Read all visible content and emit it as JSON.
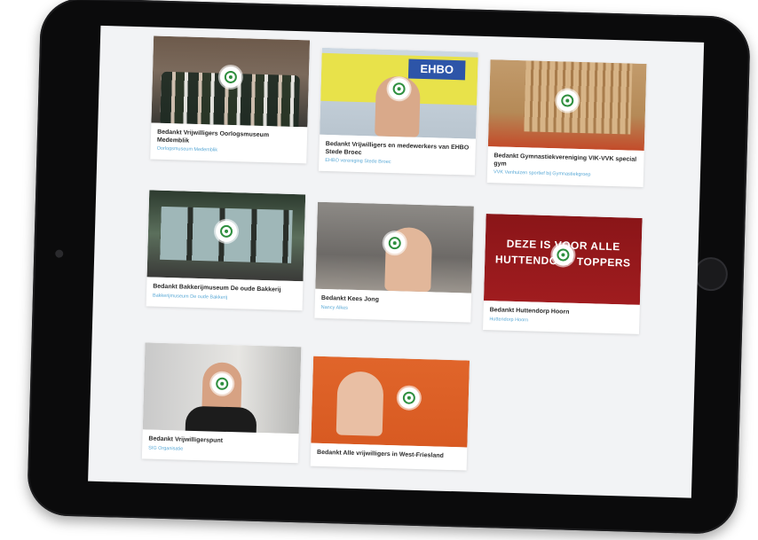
{
  "cards": [
    {
      "title": "Bedankt Vrijwilligers Oorlogsmuseum Medemblik",
      "subtitle": "Oorlogsmuseum Medemblik",
      "thumb_icon": "play-icon"
    },
    {
      "title": "Bedankt Vrijwilligers en medewerkers van EHBO Stede Broec",
      "subtitle": "EHBO vereniging Stede Broec",
      "thumb_icon": "play-icon",
      "thumb_text": "EHBO"
    },
    {
      "title": "Bedankt Gymnastiekvereniging VIK-VVK special gym",
      "subtitle": "VVK Venhuizen sportief bij Gymnastiekgroep",
      "thumb_icon": "play-icon"
    },
    {
      "title": "Bedankt Bakkerijmuseum De oude Bakkerij",
      "subtitle": "Bakkerijmuseum De oude Bakkerij",
      "thumb_icon": "play-icon"
    },
    {
      "title": "Bedankt Kees Jong",
      "subtitle": "Nancy Alkes",
      "thumb_icon": "play-icon"
    },
    {
      "title": "Bedankt Huttendorp Hoorn",
      "subtitle": "Huttendorp Hoorn",
      "thumb_icon": "play-icon",
      "thumb_text": "DEZE IS VOOR ALLE HUTTENDORP TOPPERS"
    },
    {
      "title": "Bedankt Vrijwilligerspunt",
      "subtitle": "SIG Organisatie",
      "thumb_icon": "play-icon"
    },
    {
      "title": "Bedankt Alle vrijwilligers in West-Friesland",
      "subtitle": "",
      "thumb_icon": "play-icon"
    }
  ]
}
